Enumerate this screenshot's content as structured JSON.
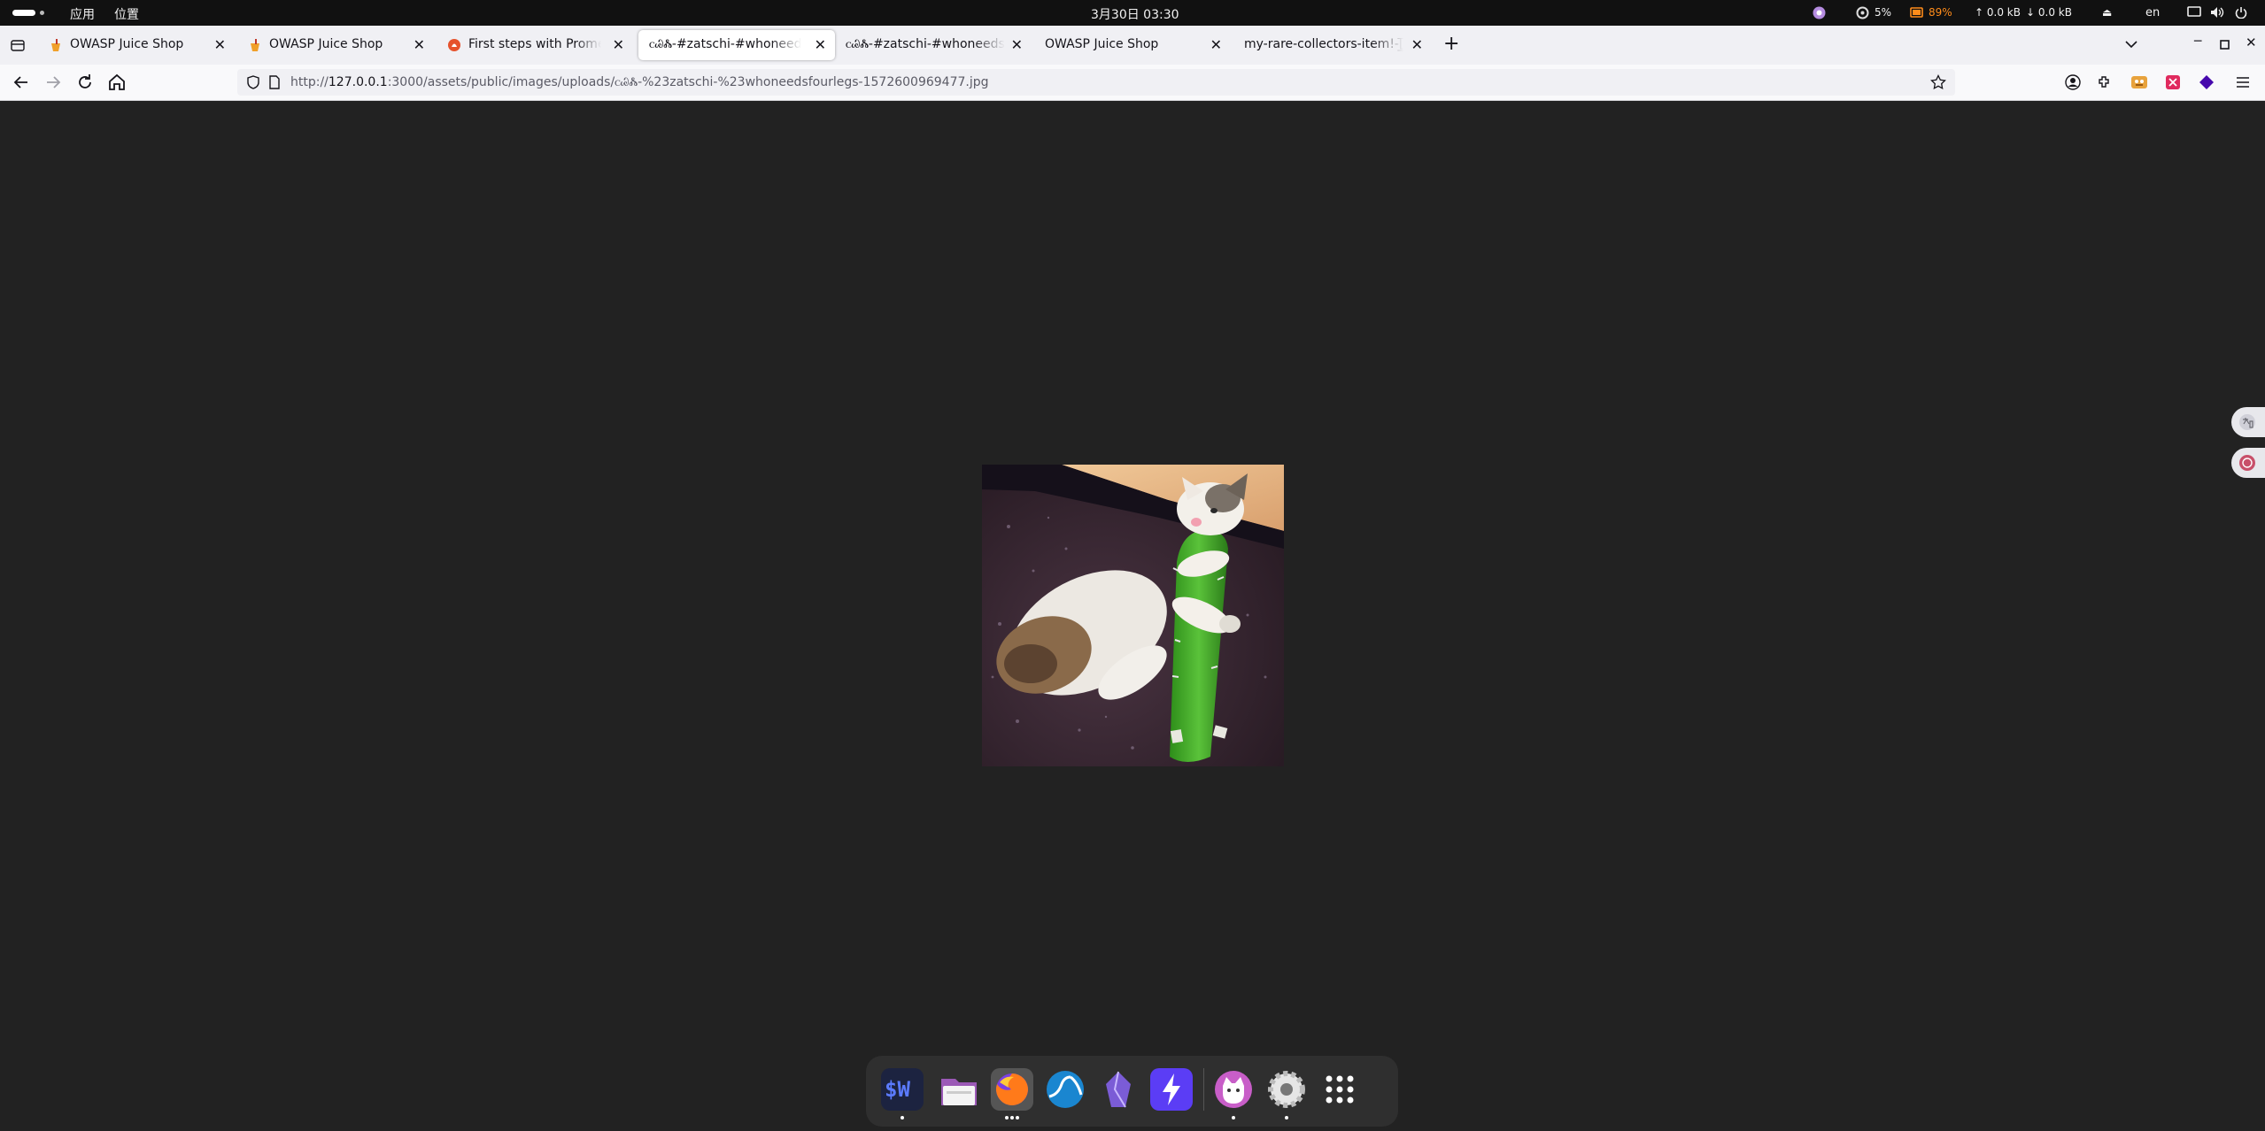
{
  "topbar": {
    "apps_label": "应用",
    "places_label": "位置",
    "clock": "3月30日  03:30",
    "cpu": "5%",
    "battery": "89%",
    "net_up": "↑ 0.0 kB",
    "net_down": "↓ 0.0 kB",
    "lang": "en"
  },
  "tabs": [
    {
      "title": "OWASP Juice Shop",
      "favicon": "juice-shop-icon"
    },
    {
      "title": "OWASP Juice Shop",
      "favicon": "juice-shop-icon"
    },
    {
      "title": "First steps with Prometheus",
      "favicon": "prometheus-icon"
    },
    {
      "title": "ꮯᏊᏜ-#zatschi-#whoneedsfourlegs",
      "favicon": "none",
      "active": true
    },
    {
      "title": "ꮯᏊᏜ-#zatschi-#whoneedsfourlegs",
      "favicon": "none"
    },
    {
      "title": "OWASP Juice Shop",
      "favicon": "none"
    },
    {
      "title": "my-rare-collectors-item!-[̲̅$̲̅(̲̅ ͡° ͜ʖ ͡°̲̅)̲̅$̲̅]",
      "favicon": "none"
    }
  ],
  "url": {
    "prefix": "http://",
    "host": "127.0.0.1",
    "rest": ":3000/assets/public/images/uploads/ꮯᏊᏜ-%23zatschi-%23whoneedsfourlegs-1572600969477.jpg"
  },
  "image": {
    "alt": "cat hugging a green cactus toy"
  },
  "dock": [
    {
      "name": "terminal-app",
      "label": "$W"
    },
    {
      "name": "files-app"
    },
    {
      "name": "firefox-app"
    },
    {
      "name": "wireshark-app"
    },
    {
      "name": "obsidian-app"
    },
    {
      "name": "bolt-app"
    },
    {
      "name": "cat-app"
    },
    {
      "name": "settings-app"
    },
    {
      "name": "app-grid"
    }
  ],
  "colors": {
    "accent_battery": "#ff8c1a",
    "page_bg": "#222222",
    "tab_strip": "#f0f0f4"
  }
}
